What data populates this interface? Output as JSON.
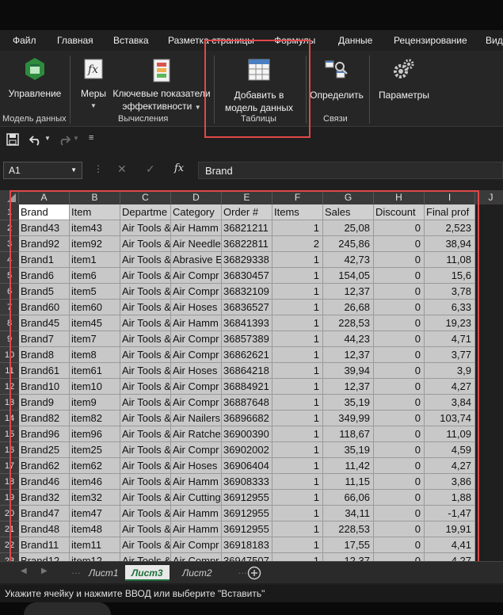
{
  "menu": {
    "tabs": [
      "Файл",
      "Главная",
      "Вставка",
      "Разметка страницы",
      "Формулы",
      "Данные",
      "Рецензирование",
      "Вид"
    ]
  },
  "ribbon": {
    "manage_label": "Управление",
    "measures_label": "Меры",
    "kpi_label_1": "Ключевые показатели",
    "kpi_label_2": "эффективности",
    "add_to_model_1": "Добавить в",
    "add_to_model_2": "модель данных",
    "detect_label": "Определить",
    "params_label": "Параметры",
    "groups": {
      "data_model": "Модель данных",
      "calculations": "Вычисления",
      "tables": "Таблицы",
      "relations": "Связи"
    }
  },
  "formula_bar": {
    "name_box": "A1",
    "fx": "fx",
    "value": "Brand"
  },
  "sheet": {
    "columns": [
      "A",
      "B",
      "C",
      "D",
      "E",
      "F",
      "G",
      "H",
      "I",
      "J"
    ],
    "rows": [
      [
        "Brand",
        "Item",
        "Departme",
        "Category",
        "Order #",
        "Items",
        "Sales",
        "Discount",
        "Final prof"
      ],
      [
        "Brand43",
        "item43",
        "Air Tools &",
        "Air Hamm",
        "36821211",
        "1",
        "25,08",
        "0",
        "2,523"
      ],
      [
        "Brand92",
        "item92",
        "Air Tools &",
        "Air Needle",
        "36822811",
        "2",
        "245,86",
        "0",
        "38,94"
      ],
      [
        "Brand1",
        "item1",
        "Air Tools &",
        "Abrasive E",
        "36829338",
        "1",
        "42,73",
        "0",
        "11,08"
      ],
      [
        "Brand6",
        "item6",
        "Air Tools &",
        "Air Compr",
        "36830457",
        "1",
        "154,05",
        "0",
        "15,6"
      ],
      [
        "Brand5",
        "item5",
        "Air Tools &",
        "Air Compr",
        "36832109",
        "1",
        "12,37",
        "0",
        "3,78"
      ],
      [
        "Brand60",
        "item60",
        "Air Tools &",
        "Air Hoses",
        "36836527",
        "1",
        "26,68",
        "0",
        "6,33"
      ],
      [
        "Brand45",
        "item45",
        "Air Tools &",
        "Air Hamm",
        "36841393",
        "1",
        "228,53",
        "0",
        "19,23"
      ],
      [
        "Brand7",
        "item7",
        "Air Tools &",
        "Air Compr",
        "36857389",
        "1",
        "44,23",
        "0",
        "4,71"
      ],
      [
        "Brand8",
        "item8",
        "Air Tools &",
        "Air Compr",
        "36862621",
        "1",
        "12,37",
        "0",
        "3,77"
      ],
      [
        "Brand61",
        "item61",
        "Air Tools &",
        "Air Hoses",
        "36864218",
        "1",
        "39,94",
        "0",
        "3,9"
      ],
      [
        "Brand10",
        "item10",
        "Air Tools &",
        "Air Compr",
        "36884921",
        "1",
        "12,37",
        "0",
        "4,27"
      ],
      [
        "Brand9",
        "item9",
        "Air Tools &",
        "Air Compr",
        "36887648",
        "1",
        "35,19",
        "0",
        "3,84"
      ],
      [
        "Brand82",
        "item82",
        "Air Tools &",
        "Air Nailers",
        "36896682",
        "1",
        "349,99",
        "0",
        "103,74"
      ],
      [
        "Brand96",
        "item96",
        "Air Tools &",
        "Air Ratche",
        "36900390",
        "1",
        "118,67",
        "0",
        "11,09"
      ],
      [
        "Brand25",
        "item25",
        "Air Tools &",
        "Air Compr",
        "36902002",
        "1",
        "35,19",
        "0",
        "4,59"
      ],
      [
        "Brand62",
        "item62",
        "Air Tools &",
        "Air Hoses",
        "36906404",
        "1",
        "11,42",
        "0",
        "4,27"
      ],
      [
        "Brand46",
        "item46",
        "Air Tools &",
        "Air Hamm",
        "36908333",
        "1",
        "11,15",
        "0",
        "3,86"
      ],
      [
        "Brand32",
        "item32",
        "Air Tools &",
        "Air Cutting",
        "36912955",
        "1",
        "66,06",
        "0",
        "1,88"
      ],
      [
        "Brand47",
        "item47",
        "Air Tools &",
        "Air Hamm",
        "36912955",
        "1",
        "34,11",
        "0",
        "-1,47"
      ],
      [
        "Brand48",
        "item48",
        "Air Tools &",
        "Air Hamm",
        "36912955",
        "1",
        "228,53",
        "0",
        "19,91"
      ],
      [
        "Brand11",
        "item11",
        "Air Tools &",
        "Air Compr",
        "36918183",
        "1",
        "17,55",
        "0",
        "4,41"
      ],
      [
        "Brand12",
        "item12",
        "Air Tools &",
        "Air Compr",
        "36947507",
        "1",
        "12,37",
        "0",
        "4,27"
      ]
    ]
  },
  "tabs": {
    "sheet1": "Лист1",
    "sheet3": "Лист3",
    "sheet2": "Лист2"
  },
  "status": {
    "text": "Укажите ячейку и нажмите ВВОД или выберите \"Вставить\""
  },
  "colors": {
    "accent_green": "#1e6f3a",
    "highlight_red": "#e04848"
  }
}
